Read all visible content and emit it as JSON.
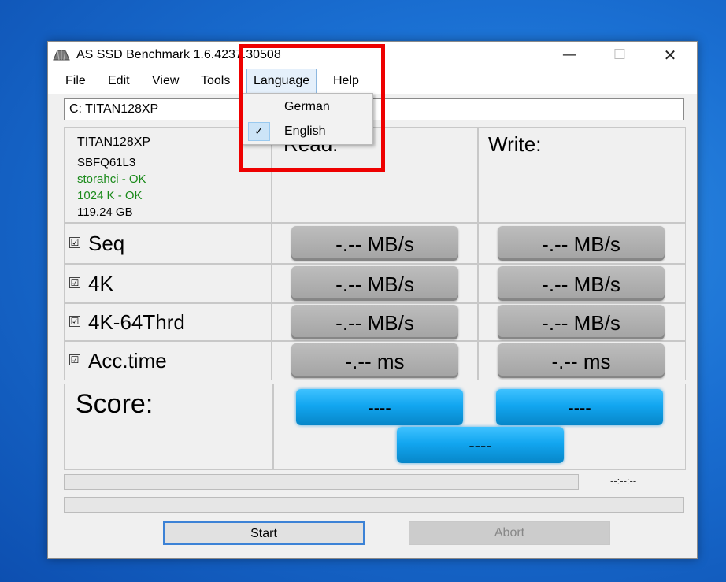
{
  "window": {
    "title": "AS SSD Benchmark 1.6.4237.30508",
    "minimize": "—",
    "maximize": "☐",
    "close": "✕"
  },
  "menu": {
    "file": "File",
    "edit": "Edit",
    "view": "View",
    "tools": "Tools",
    "language": "Language",
    "help": "Help"
  },
  "language_menu": {
    "items": [
      "German",
      "English"
    ],
    "checked": "English",
    "check_mark": "✓"
  },
  "drive": {
    "selected": "C: TITAN128XP"
  },
  "drive_info": {
    "model": "TITAN128XP",
    "firmware": "SBFQ61L3",
    "driver": "storahci - OK",
    "alignment": "1024 K - OK",
    "size": "119.24 GB",
    "ok_color": "#1a8a1a"
  },
  "columns": {
    "read": "Read:",
    "write": "Write:"
  },
  "tests": [
    {
      "label": "Seq",
      "checked": "☑",
      "read": "-.-- MB/s",
      "write": "-.-- MB/s"
    },
    {
      "label": "4K",
      "checked": "☑",
      "read": "-.-- MB/s",
      "write": "-.-- MB/s"
    },
    {
      "label": "4K-64Thrd",
      "checked": "☑",
      "read": "-.-- MB/s",
      "write": "-.-- MB/s"
    },
    {
      "label": "Acc.time",
      "checked": "☑",
      "read": "-.-- ms",
      "write": "-.-- ms"
    }
  ],
  "score": {
    "title": "Score:",
    "read": "----",
    "write": "----",
    "total": "----"
  },
  "progress": {
    "time": "--:--:--"
  },
  "buttons": {
    "start": "Start",
    "abort": "Abort"
  },
  "colors": {
    "highlight": "#ee0000",
    "score_button": "#12a6f0",
    "result_button": "#b0b0b0"
  }
}
